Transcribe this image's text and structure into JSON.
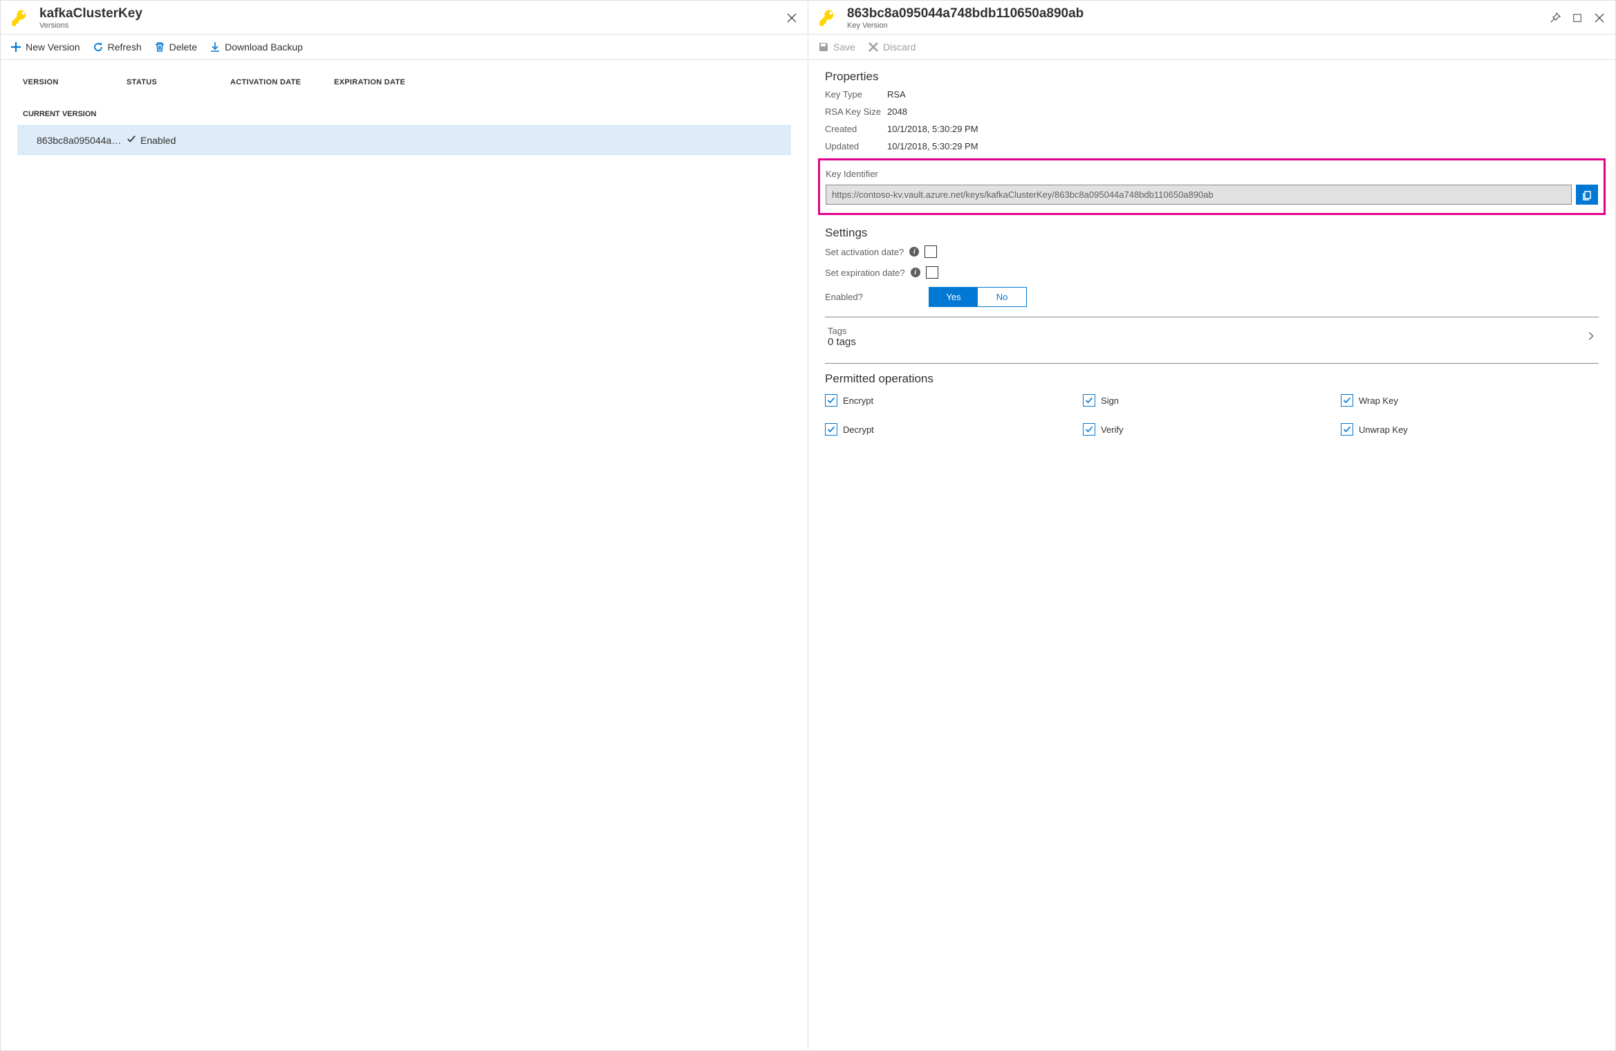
{
  "left": {
    "title": "kafkaClusterKey",
    "subtitle": "Versions",
    "toolbar": {
      "new": "New Version",
      "refresh": "Refresh",
      "delete": "Delete",
      "download": "Download Backup"
    },
    "columns": {
      "version": "VERSION",
      "status": "STATUS",
      "activation": "ACTIVATION DATE",
      "expiration": "EXPIRATION DATE"
    },
    "group": "CURRENT VERSION",
    "row": {
      "version": "863bc8a095044a…",
      "status": "Enabled"
    }
  },
  "right": {
    "title": "863bc8a095044a748bdb110650a890ab",
    "subtitle": "Key Version",
    "toolbar": {
      "save": "Save",
      "discard": "Discard"
    },
    "properties": {
      "heading": "Properties",
      "keyTypeLabel": "Key Type",
      "keyType": "RSA",
      "keySizeLabel": "RSA Key Size",
      "keySize": "2048",
      "createdLabel": "Created",
      "created": "10/1/2018, 5:30:29 PM",
      "updatedLabel": "Updated",
      "updated": "10/1/2018, 5:30:29 PM",
      "idLabel": "Key Identifier",
      "idValue": "https://contoso-kv.vault.azure.net/keys/kafkaClusterKey/863bc8a095044a748bdb110650a890ab"
    },
    "settings": {
      "heading": "Settings",
      "activation": "Set activation date?",
      "expiration": "Set expiration date?",
      "enabled": "Enabled?",
      "yes": "Yes",
      "no": "No"
    },
    "tags": {
      "label": "Tags",
      "count": "0 tags"
    },
    "ops": {
      "heading": "Permitted operations",
      "encrypt": "Encrypt",
      "sign": "Sign",
      "wrap": "Wrap Key",
      "decrypt": "Decrypt",
      "verify": "Verify",
      "unwrap": "Unwrap Key"
    }
  }
}
